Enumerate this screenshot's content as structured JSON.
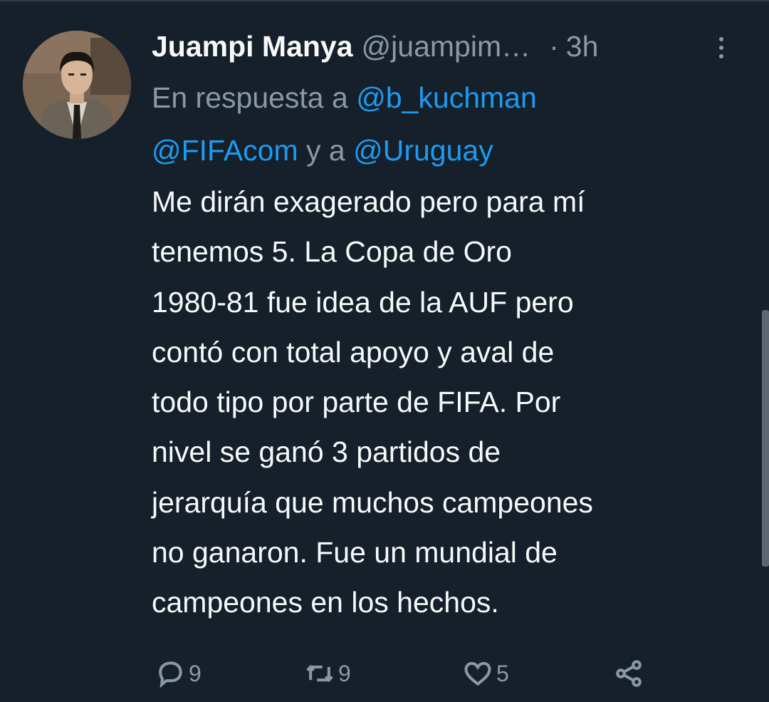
{
  "tweet": {
    "author_name": "Juampi Manya",
    "handle": "@juampim…",
    "dot": "·",
    "time": "3h",
    "reply_prefix": "En respuesta a ",
    "mention_1": "@b_kuchman",
    "mention_2": "@FIFAcom",
    "reply_join": " y a ",
    "mention_3": "@Uruguay",
    "text_lines": [
      "Me dirán exagerado pero para mí",
      "tenemos 5. La Copa de Oro",
      "1980-81 fue idea de la AUF pero",
      "contó con total apoyo y aval de",
      "todo tipo por parte de FIFA. Por",
      "nivel se ganó 3 partidos de",
      "jerarquía que muchos campeones",
      "no ganaron. Fue un mundial de",
      "campeones en los hechos."
    ]
  },
  "actions": {
    "replies": "9",
    "retweets": "9",
    "likes": "5"
  },
  "icons": {
    "reply": "reply-bubble-icon",
    "retweet": "retweet-icon",
    "like": "heart-icon",
    "share": "share-icon",
    "more": "more-vertical-icon"
  },
  "colors": {
    "background": "#15202b",
    "text": "#f7f9f9",
    "muted": "#8b98a5",
    "link": "#1d9bf0"
  }
}
